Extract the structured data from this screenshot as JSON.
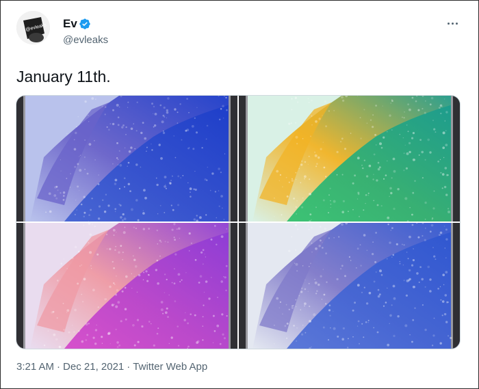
{
  "tweet": {
    "author": {
      "name": "Ev",
      "handle": "@evleaks",
      "avatar_text": "@evleaks"
    },
    "text": "January 11th.",
    "more_icon": "more-horizontal-icon",
    "verified_icon": "verified-badge-icon",
    "media": [
      {
        "colorway": "blue-violet",
        "colors": [
          "#b9c2ec",
          "#6a63c9",
          "#3f5fd1",
          "#1b3cc9"
        ]
      },
      {
        "colorway": "green-yellow",
        "colors": [
          "#d9f1e6",
          "#f2b325",
          "#2bbf6b",
          "#1a9a8f"
        ]
      },
      {
        "colorway": "pink-magenta",
        "colors": [
          "#e9dcef",
          "#ef9aa4",
          "#d443c9",
          "#8a3bd6"
        ]
      },
      {
        "colorway": "white-blue",
        "colors": [
          "#e4e8f1",
          "#7f79c9",
          "#4e6ed6",
          "#2d55d0"
        ]
      }
    ],
    "time": "3:21 AM",
    "date": "Dec 21, 2021",
    "source": "Twitter Web App",
    "separator": "·",
    "brand_color": "#1d9bf0"
  }
}
